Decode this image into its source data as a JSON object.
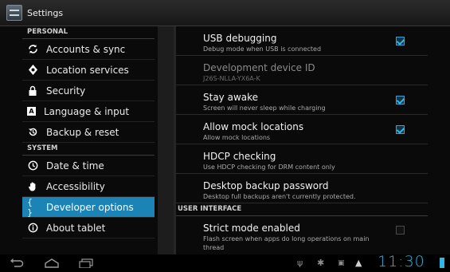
{
  "app": {
    "title": "Settings"
  },
  "sidebar": {
    "sections": [
      {
        "header": "PERSONAL",
        "items": [
          {
            "label": "Accounts & sync",
            "icon": "sync-icon"
          },
          {
            "label": "Location services",
            "icon": "location-icon"
          },
          {
            "label": "Security",
            "icon": "lock-icon"
          },
          {
            "label": "Language & input",
            "icon": "keyboard-icon"
          },
          {
            "label": "Backup & reset",
            "icon": "restore-icon"
          }
        ]
      },
      {
        "header": "SYSTEM",
        "items": [
          {
            "label": "Date & time",
            "icon": "clock-icon"
          },
          {
            "label": "Accessibility",
            "icon": "hand-icon"
          },
          {
            "label": "Developer options",
            "icon": "braces-icon",
            "active": true
          },
          {
            "label": "About tablet",
            "icon": "info-icon"
          }
        ]
      }
    ]
  },
  "prefs": [
    {
      "title": "USB debugging",
      "summary": "Debug mode when USB is connected",
      "checked": true
    },
    {
      "title": "Development device ID",
      "summary": "J26S-NLLA-YX6A-K",
      "disabled": true
    },
    {
      "title": "Stay awake",
      "summary": "Screen will never sleep while charging",
      "checked": true
    },
    {
      "title": "Allow mock locations",
      "summary": "Allow mock locations",
      "checked": true
    },
    {
      "title": "HDCP checking",
      "summary": "Use HDCP checking for DRM content only"
    },
    {
      "title": "Desktop backup password",
      "summary": "Desktop full backups aren't currently protected."
    }
  ],
  "ui_section": {
    "header": "USER INTERFACE"
  },
  "ui_prefs": [
    {
      "title": "Strict mode enabled",
      "summary": "Flash screen when apps do long operations on main thread",
      "checked": false
    }
  ],
  "status": {
    "clock": "11:30"
  },
  "colors": {
    "accent": "#33b5e5",
    "selection": "#1b83b5"
  }
}
